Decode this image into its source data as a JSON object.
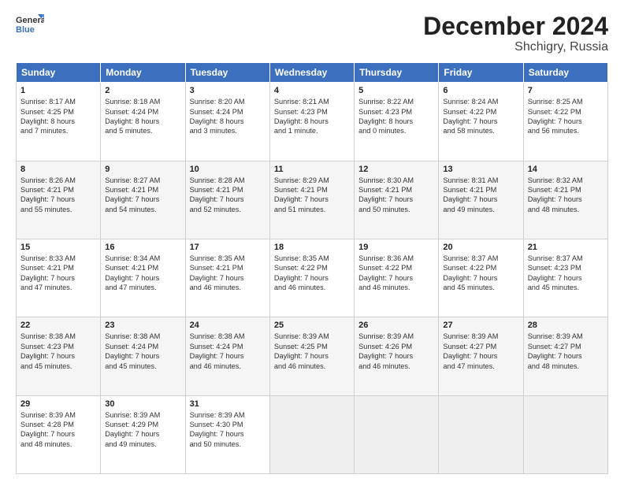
{
  "header": {
    "logo_line1": "General",
    "logo_line2": "Blue",
    "month_title": "December 2024",
    "location": "Shchigry, Russia"
  },
  "weekdays": [
    "Sunday",
    "Monday",
    "Tuesday",
    "Wednesday",
    "Thursday",
    "Friday",
    "Saturday"
  ],
  "weeks": [
    [
      {
        "day": 1,
        "text": "Sunrise: 8:17 AM\nSunset: 4:25 PM\nDaylight: 8 hours\nand 7 minutes."
      },
      {
        "day": 2,
        "text": "Sunrise: 8:18 AM\nSunset: 4:24 PM\nDaylight: 8 hours\nand 5 minutes."
      },
      {
        "day": 3,
        "text": "Sunrise: 8:20 AM\nSunset: 4:24 PM\nDaylight: 8 hours\nand 3 minutes."
      },
      {
        "day": 4,
        "text": "Sunrise: 8:21 AM\nSunset: 4:23 PM\nDaylight: 8 hours\nand 1 minute."
      },
      {
        "day": 5,
        "text": "Sunrise: 8:22 AM\nSunset: 4:23 PM\nDaylight: 8 hours\nand 0 minutes."
      },
      {
        "day": 6,
        "text": "Sunrise: 8:24 AM\nSunset: 4:22 PM\nDaylight: 7 hours\nand 58 minutes."
      },
      {
        "day": 7,
        "text": "Sunrise: 8:25 AM\nSunset: 4:22 PM\nDaylight: 7 hours\nand 56 minutes."
      }
    ],
    [
      {
        "day": 8,
        "text": "Sunrise: 8:26 AM\nSunset: 4:21 PM\nDaylight: 7 hours\nand 55 minutes."
      },
      {
        "day": 9,
        "text": "Sunrise: 8:27 AM\nSunset: 4:21 PM\nDaylight: 7 hours\nand 54 minutes."
      },
      {
        "day": 10,
        "text": "Sunrise: 8:28 AM\nSunset: 4:21 PM\nDaylight: 7 hours\nand 52 minutes."
      },
      {
        "day": 11,
        "text": "Sunrise: 8:29 AM\nSunset: 4:21 PM\nDaylight: 7 hours\nand 51 minutes."
      },
      {
        "day": 12,
        "text": "Sunrise: 8:30 AM\nSunset: 4:21 PM\nDaylight: 7 hours\nand 50 minutes."
      },
      {
        "day": 13,
        "text": "Sunrise: 8:31 AM\nSunset: 4:21 PM\nDaylight: 7 hours\nand 49 minutes."
      },
      {
        "day": 14,
        "text": "Sunrise: 8:32 AM\nSunset: 4:21 PM\nDaylight: 7 hours\nand 48 minutes."
      }
    ],
    [
      {
        "day": 15,
        "text": "Sunrise: 8:33 AM\nSunset: 4:21 PM\nDaylight: 7 hours\nand 47 minutes."
      },
      {
        "day": 16,
        "text": "Sunrise: 8:34 AM\nSunset: 4:21 PM\nDaylight: 7 hours\nand 47 minutes."
      },
      {
        "day": 17,
        "text": "Sunrise: 8:35 AM\nSunset: 4:21 PM\nDaylight: 7 hours\nand 46 minutes."
      },
      {
        "day": 18,
        "text": "Sunrise: 8:35 AM\nSunset: 4:22 PM\nDaylight: 7 hours\nand 46 minutes."
      },
      {
        "day": 19,
        "text": "Sunrise: 8:36 AM\nSunset: 4:22 PM\nDaylight: 7 hours\nand 46 minutes."
      },
      {
        "day": 20,
        "text": "Sunrise: 8:37 AM\nSunset: 4:22 PM\nDaylight: 7 hours\nand 45 minutes."
      },
      {
        "day": 21,
        "text": "Sunrise: 8:37 AM\nSunset: 4:23 PM\nDaylight: 7 hours\nand 45 minutes."
      }
    ],
    [
      {
        "day": 22,
        "text": "Sunrise: 8:38 AM\nSunset: 4:23 PM\nDaylight: 7 hours\nand 45 minutes."
      },
      {
        "day": 23,
        "text": "Sunrise: 8:38 AM\nSunset: 4:24 PM\nDaylight: 7 hours\nand 45 minutes."
      },
      {
        "day": 24,
        "text": "Sunrise: 8:38 AM\nSunset: 4:24 PM\nDaylight: 7 hours\nand 46 minutes."
      },
      {
        "day": 25,
        "text": "Sunrise: 8:39 AM\nSunset: 4:25 PM\nDaylight: 7 hours\nand 46 minutes."
      },
      {
        "day": 26,
        "text": "Sunrise: 8:39 AM\nSunset: 4:26 PM\nDaylight: 7 hours\nand 46 minutes."
      },
      {
        "day": 27,
        "text": "Sunrise: 8:39 AM\nSunset: 4:27 PM\nDaylight: 7 hours\nand 47 minutes."
      },
      {
        "day": 28,
        "text": "Sunrise: 8:39 AM\nSunset: 4:27 PM\nDaylight: 7 hours\nand 48 minutes."
      }
    ],
    [
      {
        "day": 29,
        "text": "Sunrise: 8:39 AM\nSunset: 4:28 PM\nDaylight: 7 hours\nand 48 minutes."
      },
      {
        "day": 30,
        "text": "Sunrise: 8:39 AM\nSunset: 4:29 PM\nDaylight: 7 hours\nand 49 minutes."
      },
      {
        "day": 31,
        "text": "Sunrise: 8:39 AM\nSunset: 4:30 PM\nDaylight: 7 hours\nand 50 minutes."
      },
      {
        "day": null
      },
      {
        "day": null
      },
      {
        "day": null
      },
      {
        "day": null
      }
    ]
  ]
}
